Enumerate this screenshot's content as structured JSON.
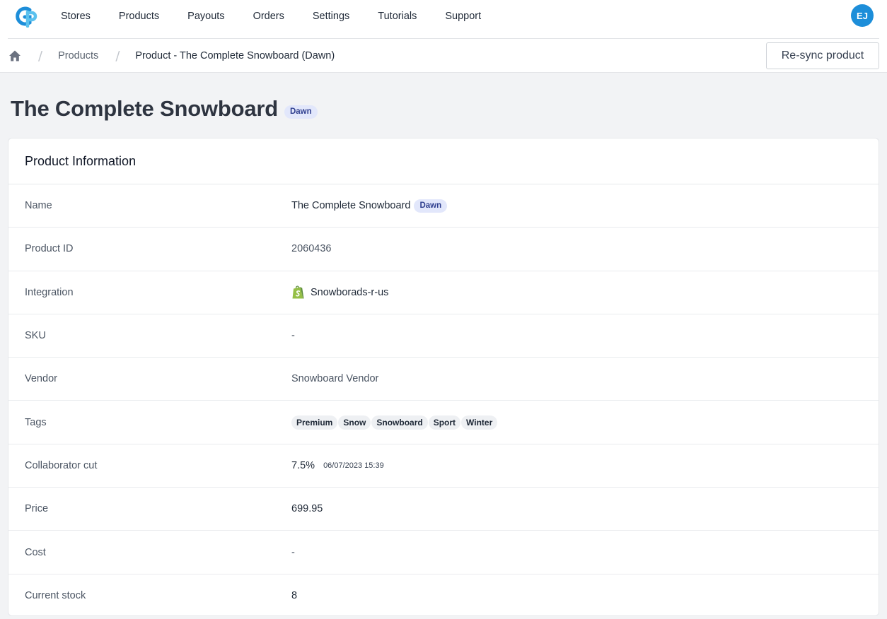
{
  "nav": {
    "items": [
      "Stores",
      "Products",
      "Payouts",
      "Orders",
      "Settings",
      "Tutorials",
      "Support"
    ],
    "avatar_initials": "EJ",
    "logo_icon": "gp-logo-icon",
    "accent_color": "#1d8ed9"
  },
  "breadcrumb": {
    "home_icon": "home-icon",
    "products": "Products",
    "current": "Product - The Complete Snowboard (Dawn)"
  },
  "actions": {
    "resync": "Re-sync product"
  },
  "page": {
    "title": "The Complete Snowboard",
    "badge": "Dawn"
  },
  "card": {
    "title": "Product Information",
    "name": {
      "label": "Name",
      "value": "The Complete Snowboard",
      "badge": "Dawn"
    },
    "product_id": {
      "label": "Product ID",
      "value": "2060436"
    },
    "integration": {
      "label": "Integration",
      "value": "Snowborads-r-us",
      "icon": "shopify-icon"
    },
    "sku": {
      "label": "SKU",
      "value": "-"
    },
    "vendor": {
      "label": "Vendor",
      "value": "Snowboard Vendor"
    },
    "tags": {
      "label": "Tags",
      "values": [
        "Premium",
        "Snow",
        "Snowboard",
        "Sport",
        "Winter"
      ]
    },
    "collaborator_cut": {
      "label": "Collaborator cut",
      "value": "7.5%",
      "date": "06/07/2023 15:39"
    },
    "price": {
      "label": "Price",
      "value": "699.95"
    },
    "cost": {
      "label": "Cost",
      "value": "-"
    },
    "stock": {
      "label": "Current stock",
      "value": "8"
    }
  }
}
